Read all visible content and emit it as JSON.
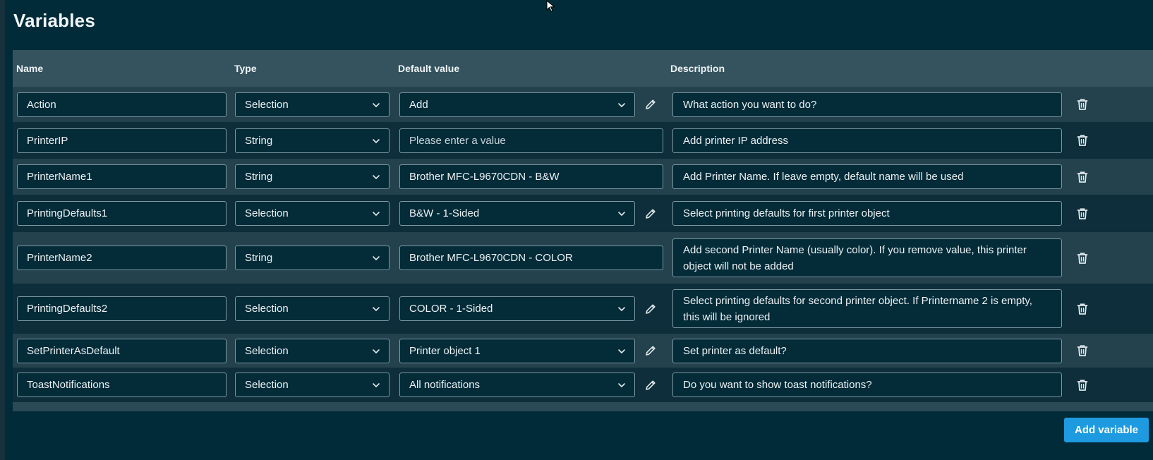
{
  "title": "Variables",
  "columns": {
    "name": "Name",
    "type": "Type",
    "default_value": "Default value",
    "description": "Description"
  },
  "rows": [
    {
      "name": "Action",
      "type": "Selection",
      "default": "Add",
      "default_is_select": true,
      "editable": true,
      "description": "What action you want to do?"
    },
    {
      "name": "PrinterIP",
      "type": "String",
      "default": "",
      "default_placeholder": "Please enter a value",
      "default_is_select": false,
      "editable": false,
      "description": "Add printer IP address"
    },
    {
      "name": "PrinterName1",
      "type": "String",
      "default": "Brother MFC-L9670CDN - B&W",
      "default_is_select": false,
      "editable": false,
      "description": "Add Printer Name. If leave empty, default name will be used"
    },
    {
      "name": "PrintingDefaults1",
      "type": "Selection",
      "default": "B&W - 1-Sided",
      "default_is_select": true,
      "editable": true,
      "description": "Select printing defaults for first printer object"
    },
    {
      "name": "PrinterName2",
      "type": "String",
      "default": "Brother MFC-L9670CDN - COLOR",
      "default_is_select": false,
      "editable": false,
      "description": "Add second Printer Name (usually color). If you remove value,  this printer object will not be added"
    },
    {
      "name": "PrintingDefaults2",
      "type": "Selection",
      "default": "COLOR - 1-Sided",
      "default_is_select": true,
      "editable": true,
      "description": "Select printing defaults for second printer object. If Printername 2 is empty, this will be ignored"
    },
    {
      "name": "SetPrinterAsDefault",
      "type": "Selection",
      "default": "Printer object 1",
      "default_is_select": true,
      "editable": true,
      "description": "Set printer as default?"
    },
    {
      "name": "ToastNotifications",
      "type": "Selection",
      "default": "All notifications",
      "default_is_select": true,
      "editable": true,
      "description": "Do you want to show toast notifications?"
    }
  ],
  "add_button_label": "Add variable",
  "colors": {
    "background": "#022b39",
    "header": "#34535e",
    "accent": "#1e9be0"
  },
  "icons": {
    "dropdown": "chevron-down-icon",
    "edit": "pencil-icon",
    "delete": "trash-icon"
  }
}
